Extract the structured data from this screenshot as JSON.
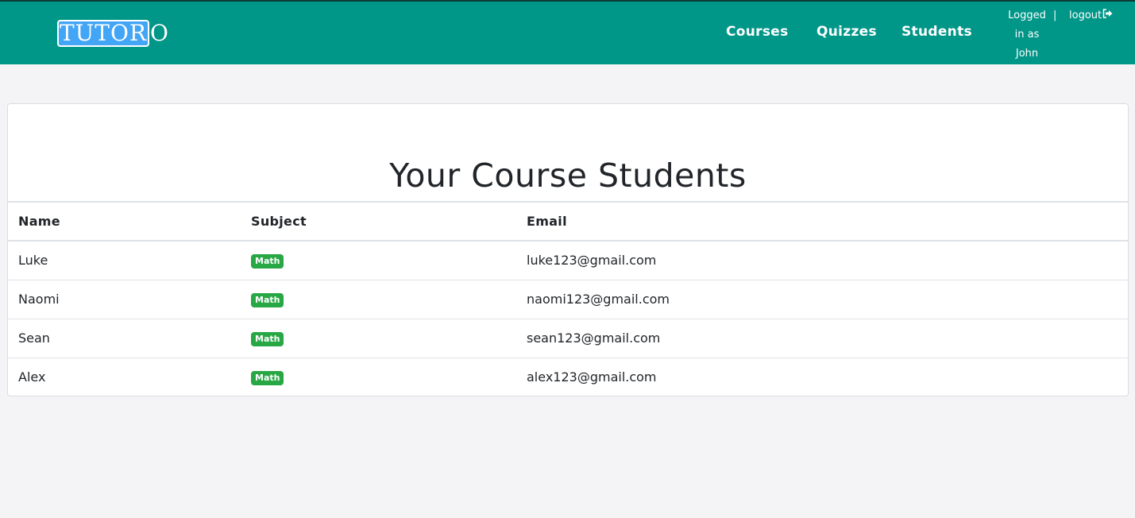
{
  "navbar": {
    "brand_main": "TUTOR",
    "brand_tail": "O",
    "links": [
      "Courses",
      "Quizzes",
      "Students"
    ],
    "login_line1": "Logged",
    "login_line2": "in as",
    "login_line3": "John",
    "separator": "|",
    "logout_label": "logout",
    "logout_icon": "sign-out-icon",
    "background_color": "#009688"
  },
  "page": {
    "title": "Your Course Students"
  },
  "table": {
    "headers": [
      "Name",
      "Subject",
      "Email"
    ],
    "rows": [
      {
        "name": "Luke",
        "subject": "Math",
        "email": "luke123@gmail.com"
      },
      {
        "name": "Naomi",
        "subject": "Math",
        "email": "naomi123@gmail.com"
      },
      {
        "name": "Sean",
        "subject": "Math",
        "email": "sean123@gmail.com"
      },
      {
        "name": "Alex",
        "subject": "Math",
        "email": "alex123@gmail.com"
      }
    ],
    "badge_color": "#28a745"
  }
}
